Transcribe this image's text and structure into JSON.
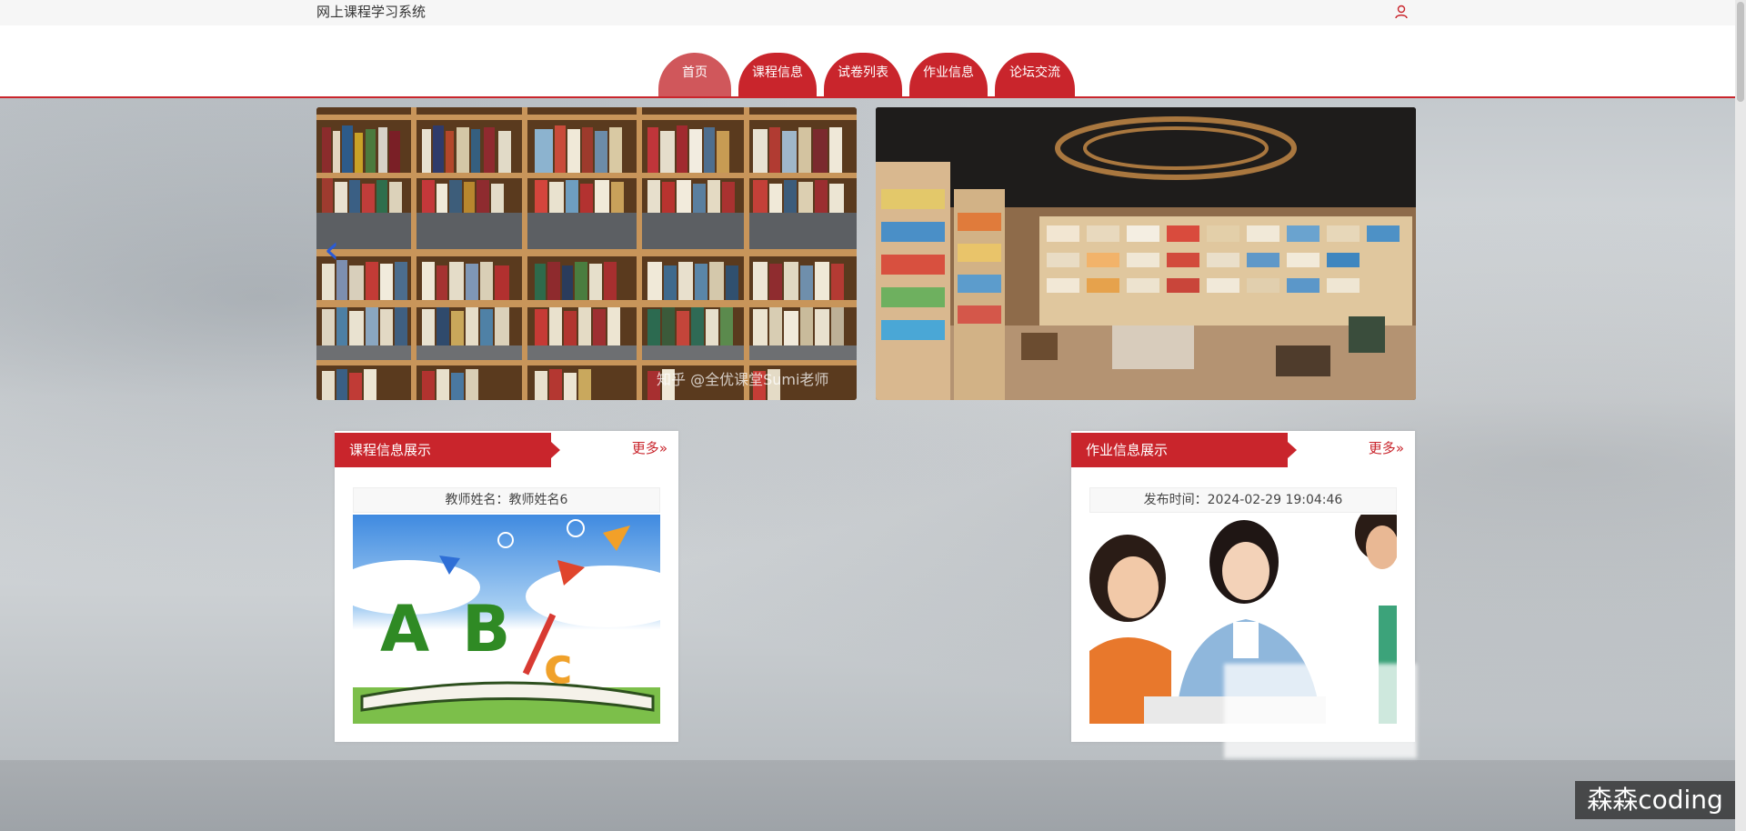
{
  "header": {
    "site_title": "网上课程学习系统",
    "user_icon": "user-icon"
  },
  "nav": {
    "tabs": [
      {
        "label": "首页",
        "active": true
      },
      {
        "label": "课程信息",
        "active": false
      },
      {
        "label": "试卷列表",
        "active": false
      },
      {
        "label": "作业信息",
        "active": false
      },
      {
        "label": "论坛交流",
        "active": false
      }
    ]
  },
  "banner": {
    "overlay_text": "知乎 @全优课堂Sumi老师"
  },
  "course_panel": {
    "title": "课程信息展示",
    "more_label": "更多",
    "card_caption": "教师姓名：教师姓名6"
  },
  "homework_panel": {
    "title": "作业信息展示",
    "more_label": "更多",
    "card_caption": "发布时间：2024-02-29 19:04:46"
  },
  "watermark": {
    "label": "森森coding"
  },
  "colors": {
    "accent": "#c9252c",
    "active_tab": "#d0575b"
  }
}
